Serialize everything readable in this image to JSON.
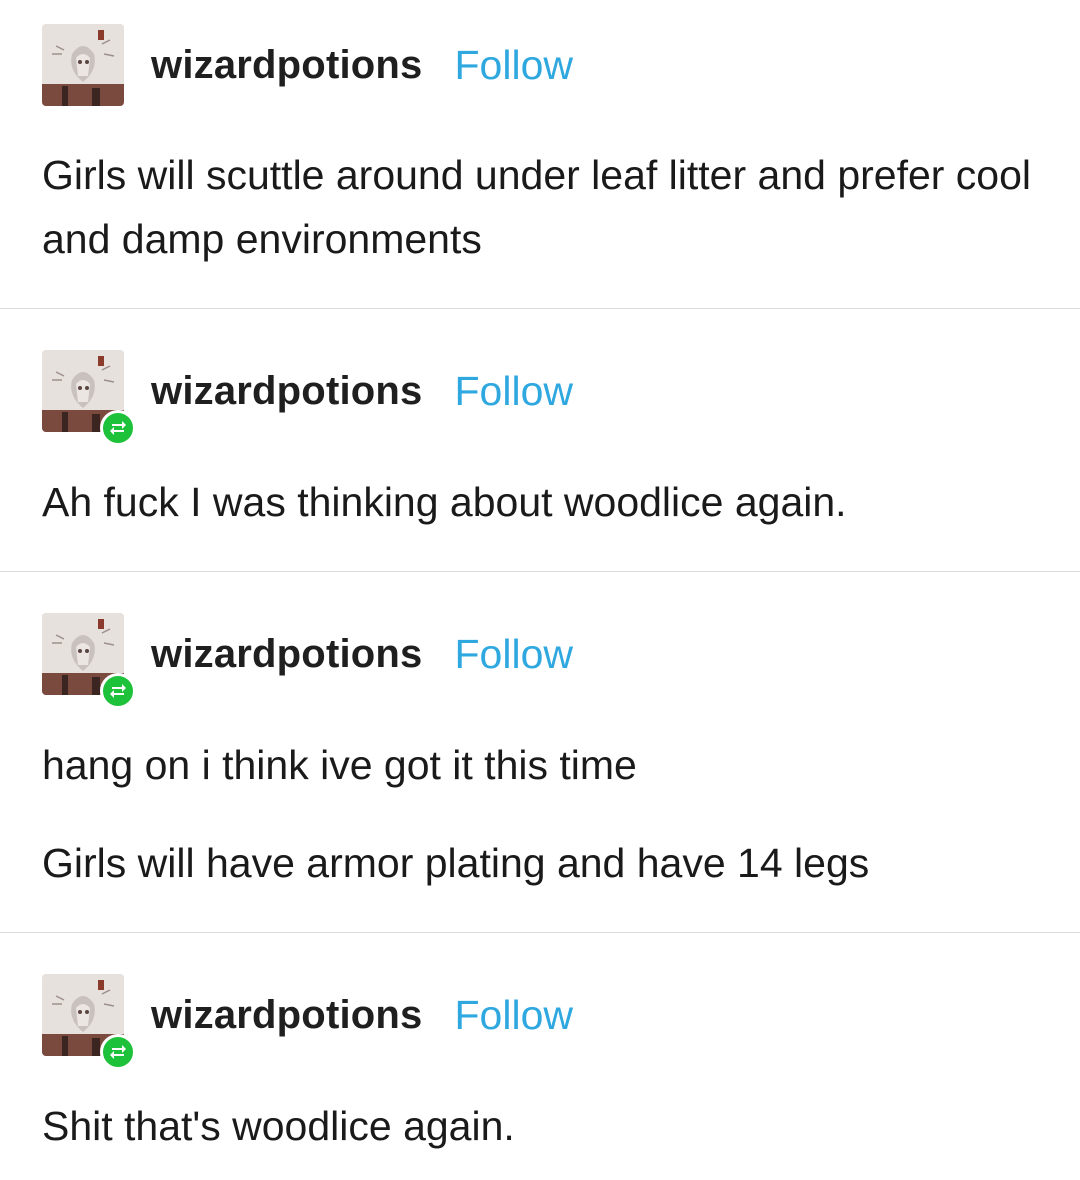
{
  "thread": {
    "posts": [
      {
        "username": "wizardpotions",
        "follow_label": "Follow",
        "is_reblog": false,
        "paragraphs": [
          "Girls will scuttle around under leaf litter and prefer cool and damp environments"
        ]
      },
      {
        "username": "wizardpotions",
        "follow_label": "Follow",
        "is_reblog": true,
        "paragraphs": [
          "Ah fuck I was thinking about woodlice again."
        ]
      },
      {
        "username": "wizardpotions",
        "follow_label": "Follow",
        "is_reblog": true,
        "paragraphs": [
          "hang on i think ive got it this time",
          "Girls will have armor plating and have 14 legs"
        ]
      },
      {
        "username": "wizardpotions",
        "follow_label": "Follow",
        "is_reblog": true,
        "paragraphs": [
          "Shit that's woodlice again."
        ]
      }
    ]
  },
  "colors": {
    "follow": "#2fa8e0",
    "reblog_badge": "#1dc13a",
    "divider": "#dcdcdc",
    "text": "#1a1a1a"
  },
  "icons": {
    "avatar": "avatar-image",
    "reblog": "reblog-icon"
  }
}
